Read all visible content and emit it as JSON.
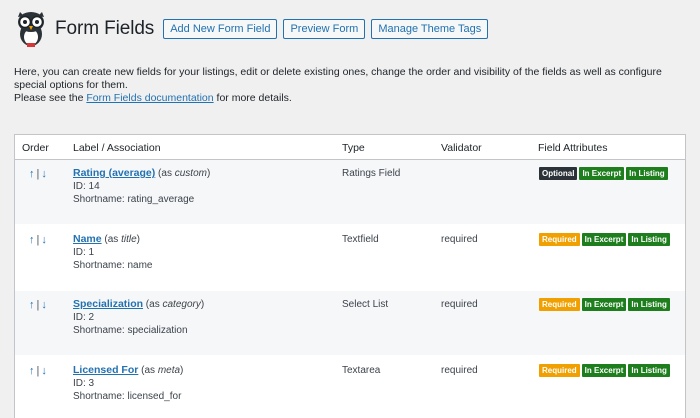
{
  "header": {
    "title": "Form Fields",
    "buttons": [
      "Add New Form Field",
      "Preview Form",
      "Manage Theme Tags"
    ]
  },
  "intro": {
    "line1": "Here, you can create new fields for your listings, edit or delete existing ones, change the order and visibility of the fields as well as configure special options for them.",
    "line2_prefix": "Please see the ",
    "line2_link": "Form Fields documentation",
    "line2_suffix": " for more details."
  },
  "table": {
    "headers": {
      "order": "Order",
      "label": "Label / Association",
      "type": "Type",
      "validator": "Validator",
      "attributes": "Field Attributes"
    },
    "rows": [
      {
        "name": "Rating (average)",
        "assoc_prefix": " (as ",
        "assoc": "custom",
        "assoc_suffix": ")",
        "id": "ID: 14",
        "shortname": "Shortname: rating_average",
        "type": "Ratings Field",
        "validator": "",
        "badges": [
          "Optional",
          "In Excerpt",
          "In Listing"
        ]
      },
      {
        "name": "Name",
        "assoc_prefix": " (as ",
        "assoc": "title",
        "assoc_suffix": ")",
        "id": "ID: 1",
        "shortname": "Shortname: name",
        "type": "Textfield",
        "validator": "required",
        "badges": [
          "Required",
          "In Excerpt",
          "In Listing"
        ]
      },
      {
        "name": "Specialization",
        "assoc_prefix": " (as ",
        "assoc": "category",
        "assoc_suffix": ")",
        "id": "ID: 2",
        "shortname": "Shortname: specialization",
        "type": "Select List",
        "validator": "required",
        "badges": [
          "Required",
          "In Excerpt",
          "In Listing"
        ]
      },
      {
        "name": "Licensed For",
        "assoc_prefix": " (as ",
        "assoc": "meta",
        "assoc_suffix": ")",
        "id": "ID: 3",
        "shortname": "Shortname: licensed_for",
        "type": "Textarea",
        "validator": "required",
        "badges": [
          "Required",
          "In Excerpt",
          "In Listing"
        ]
      }
    ]
  },
  "arrows": {
    "up": "↑",
    "sep": "|",
    "down": "↓"
  },
  "colors": {
    "accent": "#2271b1",
    "optional": "#2c3338",
    "required": "#f0a000",
    "listing": "#1e7e1e"
  }
}
